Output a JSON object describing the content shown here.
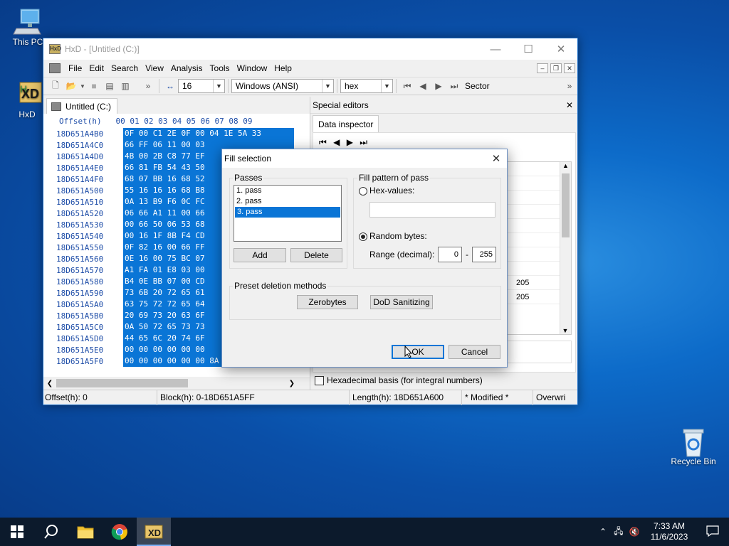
{
  "desktop": {
    "icons": [
      {
        "label": "This PC",
        "icon": "computer-icon"
      },
      {
        "label": "HxD",
        "icon": "hxd-app-icon"
      },
      {
        "label": "Recycle Bin",
        "icon": "recycle-bin-icon"
      }
    ]
  },
  "window": {
    "title": "HxD - [Untitled (C:)]",
    "menu": [
      "File",
      "Edit",
      "Search",
      "View",
      "Analysis",
      "Tools",
      "Window",
      "Help"
    ],
    "toolbar": {
      "bytes_per_row": "16",
      "charset": "Windows (ANSI)",
      "offset_base": "hex",
      "sector_label": "Sector"
    },
    "tab_label": "Untitled (C:)",
    "hex": {
      "header": "Offset(h)   00 01 02 03 04 05 06 07 08 09",
      "rows": [
        {
          "offset": "18D651A4B0",
          "bytes": "0F 00 C1 2E 0F 00 04 1E 5A 33"
        },
        {
          "offset": "18D651A4C0",
          "bytes": "66 FF 06 11 00 03"
        },
        {
          "offset": "18D651A4D0",
          "bytes": "4B 00 2B C8 77 EF"
        },
        {
          "offset": "18D651A4E0",
          "bytes": "66 81 FB 54 43 50"
        },
        {
          "offset": "18D651A4F0",
          "bytes": "68 07 BB 16 68 52"
        },
        {
          "offset": "18D651A500",
          "bytes": "55 16 16 16 68 B8"
        },
        {
          "offset": "18D651A510",
          "bytes": "0A 13 B9 F6 0C FC"
        },
        {
          "offset": "18D651A520",
          "bytes": "06 66 A1 11 00 66"
        },
        {
          "offset": "18D651A530",
          "bytes": "00 66 50 06 53 68"
        },
        {
          "offset": "18D651A540",
          "bytes": "00 16 1F 8B F4 CD"
        },
        {
          "offset": "18D651A550",
          "bytes": "0F 82 16 00 66 FF"
        },
        {
          "offset": "18D651A560",
          "bytes": "0E 16 00 75 BC 07"
        },
        {
          "offset": "18D651A570",
          "bytes": "A1 FA 01 E8 03 00"
        },
        {
          "offset": "18D651A580",
          "bytes": "B4 0E BB 07 00 CD"
        },
        {
          "offset": "18D651A590",
          "bytes": "73 6B 20 72 65 61"
        },
        {
          "offset": "18D651A5A0",
          "bytes": "63 75 72 72 65 64"
        },
        {
          "offset": "18D651A5B0",
          "bytes": "20 69 73 20 63 6F"
        },
        {
          "offset": "18D651A5C0",
          "bytes": "0A 50 72 65 73 73"
        },
        {
          "offset": "18D651A5D0",
          "bytes": "44 65 6C 20 74 6F"
        },
        {
          "offset": "18D651A5E0",
          "bytes": "00 00 00 00 00 00"
        },
        {
          "offset": "18D651A5F0",
          "bytes": "00 00 00 00 00 00 8A 01 A7 01"
        }
      ]
    },
    "special_editors": {
      "title": "Special editors",
      "tab": "Data inspector",
      "partial_values": [
        "205",
        "205"
      ],
      "hex_basis_label": "Hexadecimal basis (for integral numbers)",
      "hex_basis_checked": false
    },
    "status": {
      "offset": "Offset(h): 0",
      "block": "Block(h): 0-18D651A5FF",
      "length": "Length(h): 18D651A600",
      "modified": "* Modified *",
      "mode": "Overwri"
    }
  },
  "dialog": {
    "title": "Fill selection",
    "passes_label": "Passes",
    "passes": [
      "1. pass",
      "2. pass",
      "3. pass"
    ],
    "selected_pass": "3. pass",
    "add_label": "Add",
    "delete_label": "Delete",
    "fill_pattern_label": "Fill pattern of pass",
    "hex_values_label": "Hex-values:",
    "hex_values_value": "",
    "random_bytes_label": "Random bytes:",
    "selected_pattern": "Random bytes",
    "range_label": "Range (decimal):",
    "range_min": "0",
    "range_sep": "-",
    "range_max": "255",
    "preset_label": "Preset deletion methods",
    "zerobytes_label": "Zerobytes",
    "dod_label": "DoD Sanitizing",
    "ok_label": "OK",
    "cancel_label": "Cancel"
  },
  "taskbar": {
    "time": "7:33 AM",
    "date": "11/6/2023",
    "apps": [
      "start-icon",
      "search-icon",
      "file-explorer-icon",
      "chrome-icon",
      "hxd-app-icon"
    ]
  }
}
